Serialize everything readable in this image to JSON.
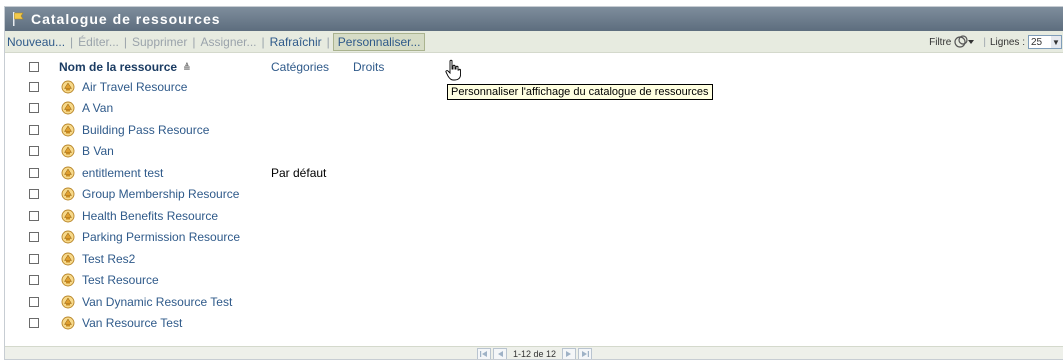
{
  "window": {
    "title": "Catalogue de ressources"
  },
  "toolbar": {
    "new_label": "Nouveau...",
    "edit_label": "Éditer...",
    "delete_label": "Supprimer",
    "assign_label": "Assigner...",
    "refresh_label": "Rafraîchir",
    "customize_label": "Personnaliser...",
    "filter_label": "Filtre",
    "lines_label": "Lignes :",
    "lines_value": "25"
  },
  "table": {
    "columns": {
      "name": "Nom de la ressource",
      "categories": "Catégories",
      "rights": "Droits"
    },
    "sort_indicator": "≜",
    "rows": [
      {
        "name": "Air Travel Resource",
        "category": ""
      },
      {
        "name": "A Van",
        "category": ""
      },
      {
        "name": "Building Pass Resource",
        "category": ""
      },
      {
        "name": "B Van",
        "category": ""
      },
      {
        "name": "entitlement test",
        "category": "Par défaut"
      },
      {
        "name": "Group Membership Resource",
        "category": ""
      },
      {
        "name": "Health Benefits Resource",
        "category": ""
      },
      {
        "name": "Parking Permission Resource",
        "category": ""
      },
      {
        "name": "Test Res2",
        "category": ""
      },
      {
        "name": "Test Resource",
        "category": ""
      },
      {
        "name": "Van Dynamic Resource Test",
        "category": ""
      },
      {
        "name": "Van Resource Test",
        "category": ""
      }
    ]
  },
  "tooltip": {
    "text": "Personnaliser l'affichage du catalogue de ressources"
  },
  "pagination": {
    "text": "1-12 de 12"
  },
  "colors": {
    "titlebar": "#6b7b8c",
    "toolbar": "#e7ebe0",
    "link": "#2f5a8a",
    "tooltip_bg": "#ffffe1"
  }
}
